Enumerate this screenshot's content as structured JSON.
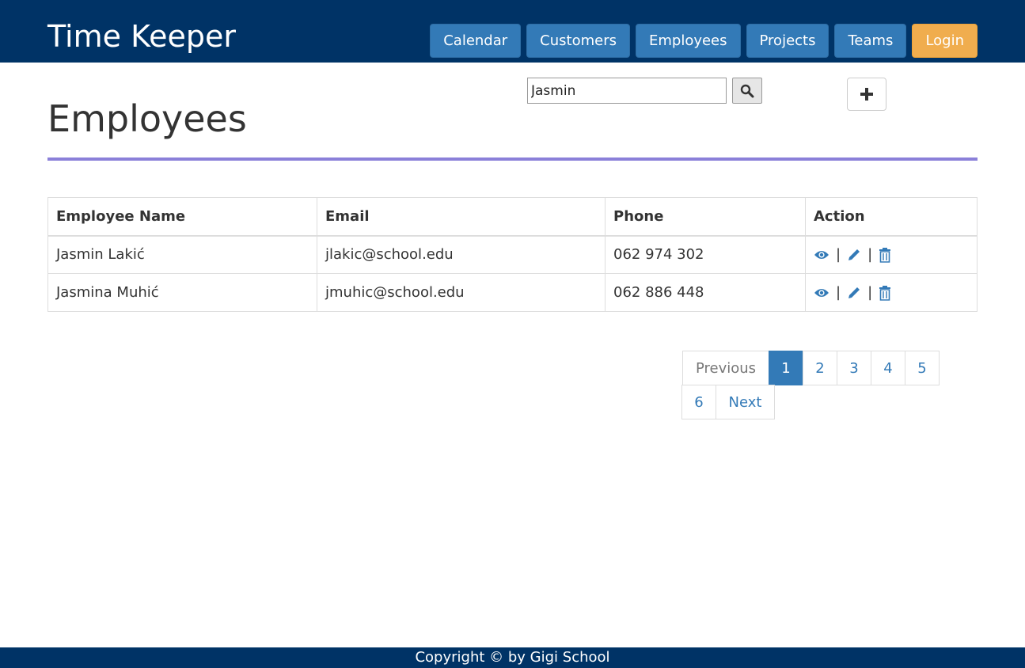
{
  "app": {
    "brand": "Time Keeper"
  },
  "nav": {
    "items": [
      "Calendar",
      "Customers",
      "Employees",
      "Projects",
      "Teams"
    ],
    "login": "Login"
  },
  "search": {
    "value": "Jasmin",
    "button_icon": "search-icon"
  },
  "add_button_icon": "plus-icon",
  "page": {
    "title": "Employees"
  },
  "table": {
    "headers": [
      "Employee Name",
      "Email",
      "Phone",
      "Action"
    ],
    "rows": [
      {
        "name": "Jasmin Lakić",
        "email": "jlakic@school.edu",
        "phone": "062 974 302"
      },
      {
        "name": "Jasmina Muhić",
        "email": "jmuhic@school.edu",
        "phone": "062 886 448"
      }
    ],
    "action_icons": [
      "eye-icon",
      "pencil-icon",
      "trash-icon"
    ],
    "separator": "|"
  },
  "pagination": {
    "previous": "Previous",
    "pages": [
      "1",
      "2",
      "3",
      "4",
      "5",
      "6"
    ],
    "active_page": "1",
    "next": "Next"
  },
  "footer": {
    "text": "Copyright © by Gigi School"
  },
  "colors": {
    "header": "#003366",
    "primary": "#337ab7",
    "login": "#f0ad4e",
    "rule": "#8b80d9"
  }
}
